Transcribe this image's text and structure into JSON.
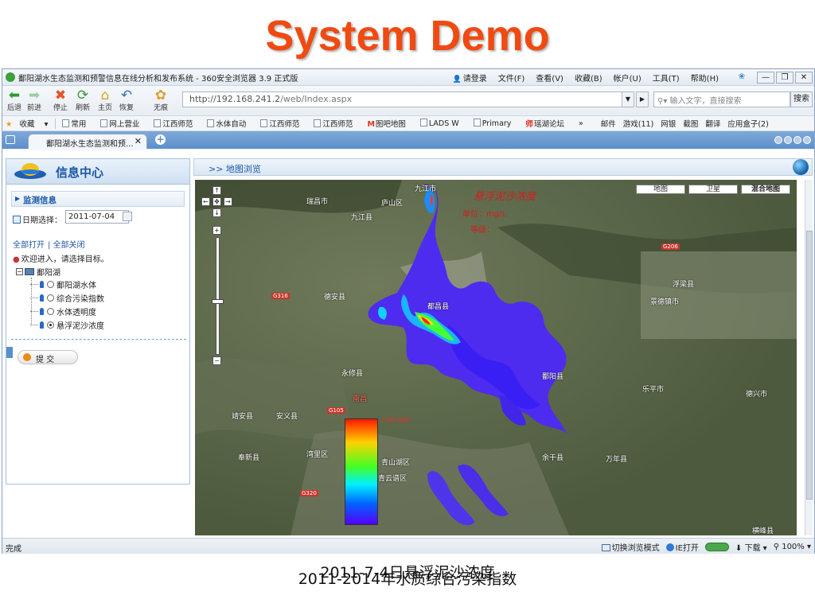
{
  "slide": {
    "title": "System Demo"
  },
  "browser": {
    "window_title": "鄱阳湖水生态监测和预警信息在线分析和发布系统 - 360安全浏览器 3.9 正式版",
    "menu": [
      "请登录",
      "文件(F)",
      "查看(V)",
      "收藏(B)",
      "帐户(U)",
      "工具(T)",
      "帮助(H)"
    ],
    "nav": {
      "back": "后退",
      "forward": "前进",
      "stop": "停止",
      "refresh": "刷新",
      "home": "主页",
      "restore": "恢复",
      "no_trace": "无痕"
    },
    "url_host": "http://192.168.241.2",
    "url_path": "/web/Index.aspx",
    "search_placeholder": "输入文字，直接搜索",
    "search_button": "搜索",
    "favorites": [
      "收藏",
      "常用",
      "网上营业",
      "江西师范",
      "水体自动",
      "江西师范",
      "江西师范",
      "图吧地图",
      "LADS W",
      "Primary",
      "瑶湖论坛",
      "»"
    ],
    "favorites_right": [
      "邮件",
      "游戏(11)",
      "网银",
      "截图",
      "翻译",
      "应用盒子(2)"
    ],
    "tab_title": "鄱阳湖水生态监测和预...",
    "status": "完成",
    "status_right": {
      "mode": "切换浏览模式",
      "ie": "IE打开",
      "download": "下载",
      "zoom": "100%"
    }
  },
  "left_panel": {
    "title": "信息中心",
    "section": "监测信息",
    "date_label": "日期选择：",
    "date_value": "2011-07-04",
    "open_all": "全部打开",
    "close_all": "全部关闭",
    "welcome": "欢迎进入，请选择目标。",
    "tree_root": "鄱阳湖",
    "tree_items": [
      "鄱阳湖水体",
      "综合污染指数",
      "水体透明度",
      "悬浮泥沙浓度"
    ],
    "selected_index": 3,
    "submit": "提 交"
  },
  "map_panel": {
    "header": ">> 地图浏览",
    "map_types": [
      "地图",
      "卫星",
      "混合地图"
    ],
    "legend_title": "悬浮泥沙浓度",
    "legend_unit_line": "单位：mg/L",
    "legend_sub_line": "等级：",
    "legend_max": "230.000",
    "place_labels": [
      "九江市",
      "庐山区",
      "瑞昌市",
      "九江县",
      "德安县",
      "都昌县",
      "浮梁县",
      "景德镇市",
      "永修县",
      "鄱阳县",
      "乐平市",
      "德兴市",
      "靖安县",
      "安义县",
      "南昌",
      "奉新县",
      "湾里区",
      "青山湖区",
      "青云谱区",
      "余干县",
      "万年县",
      "横峰县"
    ],
    "road_labels": [
      "G206",
      "G316",
      "G105",
      "G320"
    ]
  },
  "caption": {
    "line1": "2011-7-4日悬浮泥沙浓度",
    "line2": "2011-2014年水质综合污染指数"
  }
}
